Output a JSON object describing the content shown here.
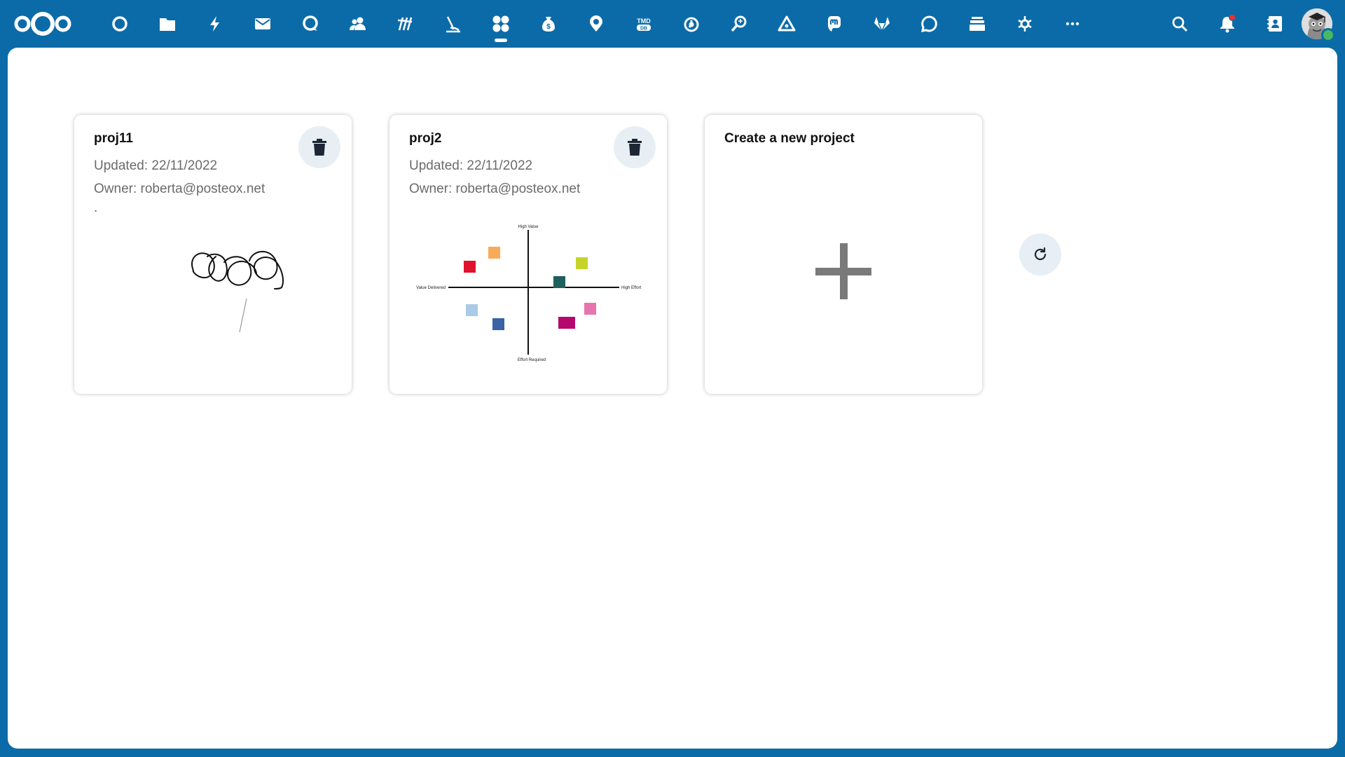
{
  "header": {
    "apps": [
      {
        "name": "dashboard-icon"
      },
      {
        "name": "files-icon"
      },
      {
        "name": "activity-icon"
      },
      {
        "name": "mail-icon"
      },
      {
        "name": "talk-icon"
      },
      {
        "name": "contacts-icon"
      },
      {
        "name": "news-icon"
      },
      {
        "name": "bookmarks-icon"
      },
      {
        "name": "whiteboard-icon"
      },
      {
        "name": "cospend-icon"
      },
      {
        "name": "maps-icon"
      },
      {
        "name": "tmdb-icon"
      },
      {
        "name": "timer-icon"
      },
      {
        "name": "find-icon"
      },
      {
        "name": "triangle-app-icon"
      },
      {
        "name": "mastodon-icon"
      },
      {
        "name": "gitlab-icon"
      },
      {
        "name": "chat-icon"
      },
      {
        "name": "deck-icon"
      },
      {
        "name": "tweak-icon"
      },
      {
        "name": "more-apps-icon"
      }
    ],
    "tmdb_label_top": "TMD",
    "tmdb_label_bottom": "DB",
    "active_app": "whiteboard-icon"
  },
  "colors": {
    "header_bg": "#0b6ba8",
    "card_button_bg": "#e7eff4",
    "status_online": "#46ba61",
    "notification": "#e9322d"
  },
  "projects": [
    {
      "title": "proj11",
      "updated": "Updated: 22/11/2022",
      "owner": "Owner: roberta@posteox.net",
      "extra": "."
    },
    {
      "title": "proj2",
      "updated": "Updated: 22/11/2022",
      "owner": "Owner: roberta@posteox.net",
      "preview_labels": {
        "top": "High Value",
        "left": "Value Delivered",
        "right": "High Effort",
        "bottom": "Effort Required"
      }
    }
  ],
  "create": {
    "title": "Create a new project"
  }
}
